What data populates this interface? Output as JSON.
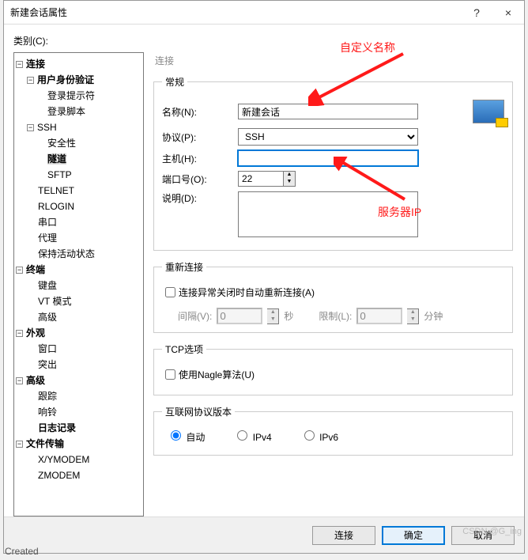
{
  "window": {
    "title": "新建会话属性",
    "help": "?",
    "close": "×"
  },
  "category_label": "类别(C):",
  "tree": {
    "connection": "连接",
    "auth": "用户身份验证",
    "login_prompt": "登录提示符",
    "login_script": "登录脚本",
    "ssh": "SSH",
    "security": "安全性",
    "tunnel": "隧道",
    "sftp": "SFTP",
    "telnet": "TELNET",
    "rlogin": "RLOGIN",
    "serial": "串口",
    "proxy": "代理",
    "keepalive": "保持活动状态",
    "terminal": "终端",
    "keyboard": "键盘",
    "vtmode": "VT 模式",
    "advanced_term": "高级",
    "appearance": "外观",
    "window": "窗口",
    "highlight": "突出",
    "advanced": "高级",
    "trace": "跟踪",
    "bell": "响铃",
    "logging": "日志记录",
    "filetransfer": "文件传输",
    "xymodem": "X/YMODEM",
    "zmodem": "ZMODEM"
  },
  "panel": {
    "breadcrumb": "连接",
    "general": {
      "legend": "常规",
      "name_label": "名称(N):",
      "name_value": "新建会话",
      "protocol_label": "协议(P):",
      "protocol_value": "SSH",
      "host_label": "主机(H):",
      "host_value": "",
      "port_label": "端口号(O):",
      "port_value": "22",
      "desc_label": "说明(D):",
      "desc_value": ""
    },
    "reconnect": {
      "legend": "重新连接",
      "checkbox": "连接异常关闭时自动重新连接(A)",
      "interval_label": "间隔(V):",
      "interval_value": "0",
      "seconds": "秒",
      "limit_label": "限制(L):",
      "limit_value": "0",
      "minutes": "分钟"
    },
    "tcp": {
      "legend": "TCP选项",
      "nagle": "使用Nagle算法(U)"
    },
    "ipver": {
      "legend": "互联网协议版本",
      "auto": "自动",
      "ipv4": "IPv4",
      "ipv6": "IPv6"
    }
  },
  "buttons": {
    "connect": "连接",
    "ok": "确定",
    "cancel": "取消"
  },
  "annotations": {
    "custom_name": "自定义名称",
    "server_ip": "服务器IP"
  },
  "watermark": "CSDN @G_ing",
  "created_text": "Created"
}
